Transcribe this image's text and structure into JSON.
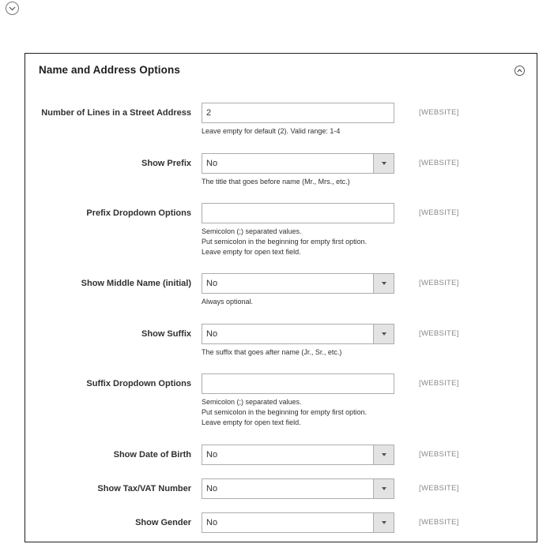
{
  "top_toggle": {
    "icon": "chevron-down-icon"
  },
  "panel": {
    "title": "Name and Address Options",
    "collapse_icon": "chevron-up-icon"
  },
  "fields": [
    {
      "label": "Number of Lines in a Street Address",
      "type": "text",
      "value": "2",
      "scope": "[WEBSITE]",
      "notes": [
        "Leave empty for default (2). Valid range: 1-4"
      ]
    },
    {
      "label": "Show Prefix",
      "type": "select",
      "value": "No",
      "scope": "[WEBSITE]",
      "notes": [
        "The title that goes before name (Mr., Mrs., etc.)"
      ]
    },
    {
      "label": "Prefix Dropdown Options",
      "type": "text",
      "value": "",
      "scope": "[WEBSITE]",
      "notes": [
        "Semicolon (;) separated values.",
        "Put semicolon in the beginning for empty first option.",
        "Leave empty for open text field."
      ]
    },
    {
      "label": "Show Middle Name (initial)",
      "type": "select",
      "value": "No",
      "scope": "[WEBSITE]",
      "notes": [
        "Always optional."
      ]
    },
    {
      "label": "Show Suffix",
      "type": "select",
      "value": "No",
      "scope": "[WEBSITE]",
      "notes": [
        "The suffix that goes after name (Jr., Sr., etc.)"
      ]
    },
    {
      "label": "Suffix Dropdown Options",
      "type": "text",
      "value": "",
      "scope": "[WEBSITE]",
      "notes": [
        "Semicolon (;) separated values.",
        "Put semicolon in the beginning for empty first option.",
        "Leave empty for open text field."
      ]
    },
    {
      "label": "Show Date of Birth",
      "type": "select",
      "value": "No",
      "scope": "[WEBSITE]",
      "notes": []
    },
    {
      "label": "Show Tax/VAT Number",
      "type": "select",
      "value": "No",
      "scope": "[WEBSITE]",
      "notes": []
    },
    {
      "label": "Show Gender",
      "type": "select",
      "value": "No",
      "scope": "[WEBSITE]",
      "notes": []
    }
  ]
}
